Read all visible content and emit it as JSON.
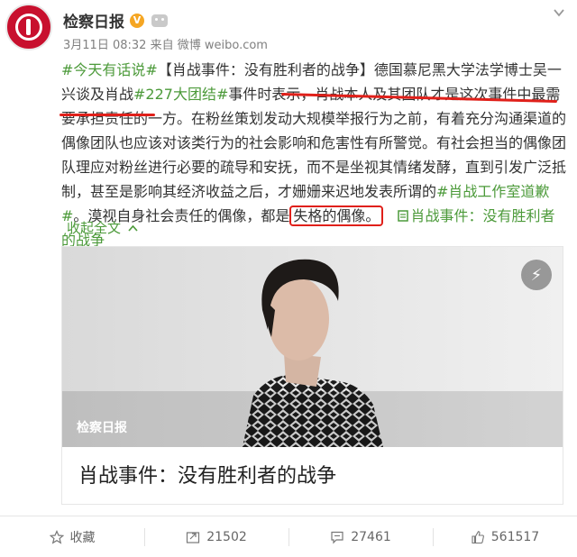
{
  "account": {
    "name": "检察日报",
    "verified_badge": "V",
    "avatar_text": "检察日报",
    "date": "3月11日 08:32",
    "source_prefix": "来自",
    "source": "微博 weibo.com"
  },
  "post": {
    "t1": "#今天有话说#",
    "t2": "【肖战事件：没有胜利者的战争】德国慕尼黑大学法学博士吴一兴谈及肖战",
    "t3": "#227大团结#",
    "t4": "事件时表示，肖战本人及其团队才是这次事件中最需要承担责任的一方。在粉丝策划发动大规模举报行为之前，有着充分沟通渠道的偶像团队也应该对该类行为的社会影响和危害性有所警觉。有社会担当的偶像团队理应对粉丝进行必要的疏导和安抚，而不是坐视其情绪发酵，直到引发广泛抵制，甚至是影响其经济收益之后，才姗姗来迟地发表所谓的",
    "t5": "#肖战工作室道歉#",
    "t6": "。漠视自身社会责任的偶像，都是",
    "t7": "失格的偶像。",
    "t8": "肖战事件：没有胜利者的战争",
    "collapse": "收起全文"
  },
  "card": {
    "source": "检察日报",
    "title": "肖战事件：没有胜利者的战争"
  },
  "footer": {
    "favorite": "收藏",
    "repost": "21502",
    "comment": "27461",
    "like": "561517"
  },
  "colors": {
    "topic_green": "#4c9a3a",
    "annotation_red": "#e0201a",
    "brand_red": "#c8102e"
  }
}
